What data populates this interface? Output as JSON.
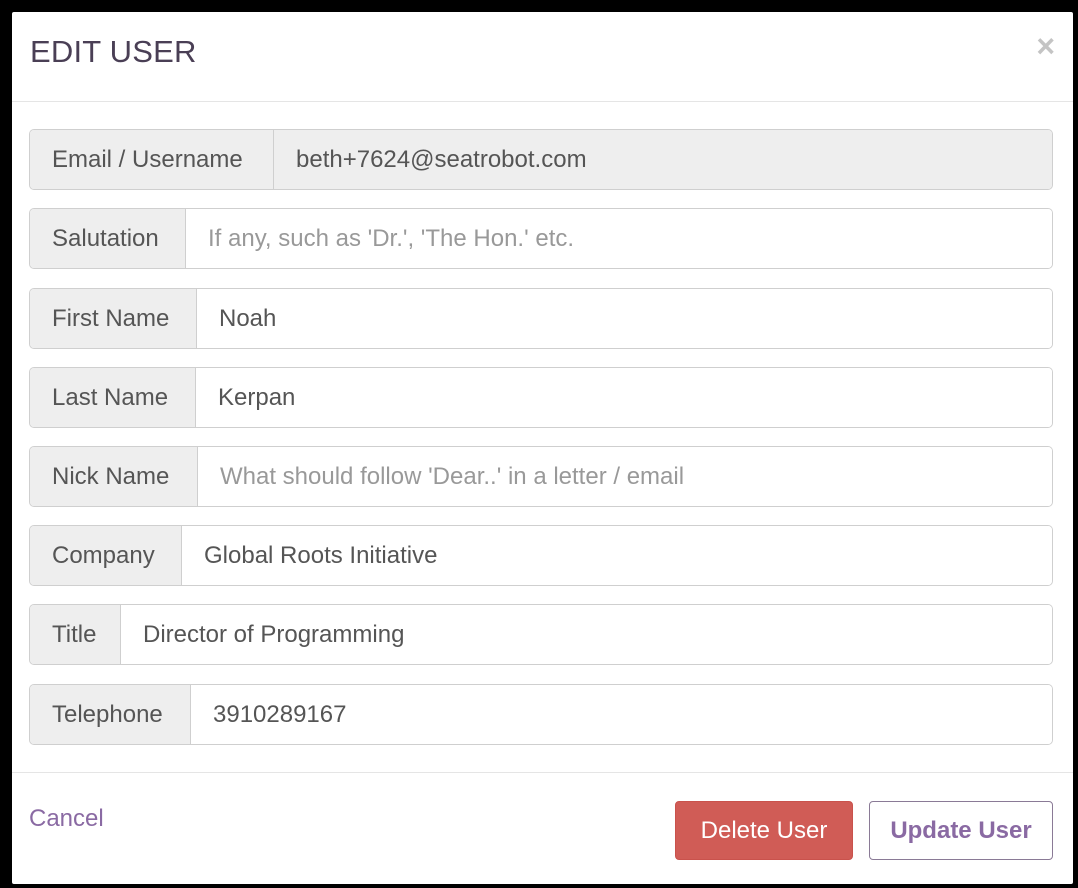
{
  "modal": {
    "title": "EDIT USER",
    "close_symbol": "×"
  },
  "fields": {
    "email": {
      "label": "Email / Username",
      "value": "beth+7624@seatrobot.com",
      "placeholder": ""
    },
    "salutation": {
      "label": "Salutation",
      "value": "",
      "placeholder": "If any, such as 'Dr.', 'The Hon.' etc."
    },
    "first_name": {
      "label": "First Name",
      "value": "Noah",
      "placeholder": ""
    },
    "last_name": {
      "label": "Last Name",
      "value": "Kerpan",
      "placeholder": ""
    },
    "nick_name": {
      "label": "Nick Name",
      "value": "",
      "placeholder": "What should follow 'Dear..' in a letter / email"
    },
    "company": {
      "label": "Company",
      "value": "Global Roots Initiative",
      "placeholder": ""
    },
    "title": {
      "label": "Title",
      "value": "Director of Programming",
      "placeholder": ""
    },
    "telephone": {
      "label": "Telephone",
      "value": "3910289167",
      "placeholder": ""
    }
  },
  "footer": {
    "cancel_label": "Cancel",
    "delete_label": "Delete User",
    "update_label": "Update User"
  },
  "colors": {
    "accent": "#8a6aa3",
    "danger": "#d05c56",
    "label_bg": "#eeeeee"
  }
}
